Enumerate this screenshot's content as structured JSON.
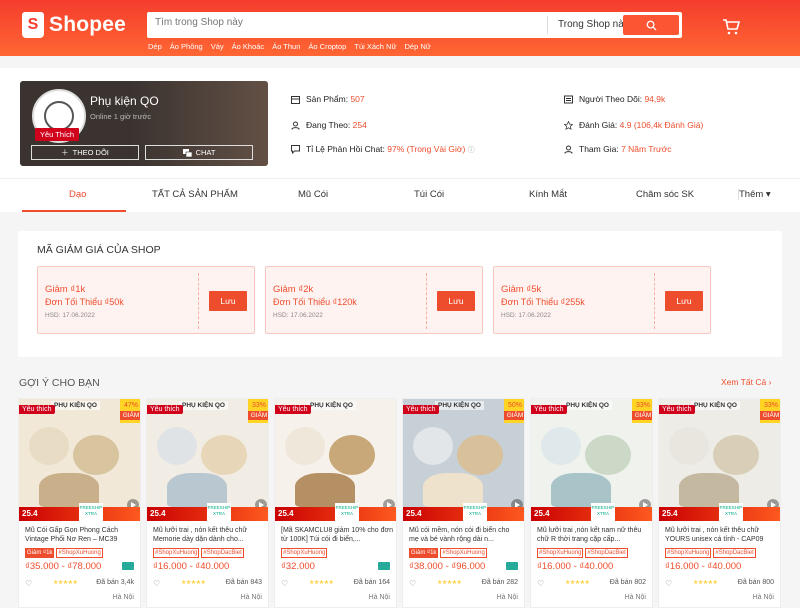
{
  "header": {
    "logo_text": "Shopee",
    "logo_mark": "S",
    "search_placeholder": "Tìm trong Shop này",
    "search_scope": "Trong Shop này",
    "hints": [
      "Dép",
      "Áo Phông",
      "Váy",
      "Áo Khoác",
      "Áo Thun",
      "Áo Croptop",
      "Túi Xách Nữ",
      "Dép Nữ"
    ],
    "colors": {
      "brand": "#ee4d2d"
    }
  },
  "shop": {
    "name": "Phụ kiện QO",
    "online": "Online 1 giờ trước",
    "favorite_badge": "Yêu Thích",
    "follow_label": "THEO DÕI",
    "follow_icon": "plus-icon",
    "chat_label": "CHAT",
    "chat_icon": "chat-icon",
    "stats": {
      "products_label": "Sản Phẩm:",
      "products": "507",
      "following_label": "Đang Theo:",
      "following": "254",
      "chat_label": "Tỉ Lệ Phản Hồi Chat:",
      "chat": "97% (Trong Vài Giờ)",
      "followers_label": "Người Theo Dõi:",
      "followers": "94,9k",
      "rating_label": "Đánh Giá:",
      "rating": "4.9 (106,4k Đánh Giá)",
      "joined_label": "Tham Gia:",
      "joined": "7 Năm Trước"
    }
  },
  "tabs": [
    "Dạo",
    "TẤT CẢ SẢN PHẨM",
    "Mũ Cói",
    "Túi Cói",
    "Kính Mắt",
    "Chăm sóc SK"
  ],
  "more_tab": "Thêm ▾",
  "vouchers": {
    "title": "MÃ GIẢM GIÁ CỦA SHOP",
    "items": [
      {
        "amount": "Giảm ₫1k",
        "min": "Đơn Tối Thiểu ₫50k",
        "expiry": "HSD: 17.06.2022",
        "button": "Lưu"
      },
      {
        "amount": "Giảm ₫2k",
        "min": "Đơn Tối Thiểu ₫120k",
        "expiry": "HSD: 17.06.2022",
        "button": "Lưu"
      },
      {
        "amount": "Giảm ₫5k",
        "min": "Đơn Tối Thiểu ₫255k",
        "expiry": "HSD: 17.06.2022",
        "button": "Lưu"
      }
    ]
  },
  "recommend": {
    "title": "GỢI Ý CHO BẠN",
    "see_all": "Xem Tất Cả",
    "see_all_arrow": "›",
    "products": [
      {
        "favorite": "Yêu thích",
        "brand": "PHỤ KIỆN QO",
        "discount": "47%",
        "discount_label": "GIẢM",
        "promo_date": "25.4",
        "freeship": "FREESHIP XTRA",
        "name": "Mũ Cói Gấp Gọn Phong Cách Vintage Phối Nơ Ren – MC39",
        "tags": [
          "Giảm ₫1k",
          "#ShopXuHuong"
        ],
        "price": "₫35.000 - ₫78.000",
        "sold": "Đã bán 3,4k",
        "location": "Hà Nội",
        "truck": true,
        "heart": "♡",
        "stars": "★★★★★"
      },
      {
        "favorite": "Yêu thích",
        "brand": "PHỤ KIỆN QO",
        "discount": "33%",
        "discount_label": "GIẢM",
        "promo_date": "25.4",
        "freeship": "FREESHIP XTRA",
        "name": "Mũ lưỡi trai , nón kết thêu chữ Memorie dày dặn dành cho...",
        "tags": [
          "#ShopXuHuong",
          "#ShopDacBiet"
        ],
        "price": "₫16.000 - ₫40.000",
        "sold": "Đã bán 843",
        "location": "Hà Nội",
        "truck": false,
        "heart": "♡",
        "stars": "★★★★★"
      },
      {
        "favorite": "Yêu thích",
        "brand": "PHỤ KIỆN QO",
        "discount": "",
        "discount_label": "",
        "promo_date": "25.4",
        "freeship": "FREESHIP XTRA",
        "name": "[Mã SKAMCLU8 giảm 10% cho đơn từ 100K] Túi cói đi biển,...",
        "tags": [
          "#ShopXuHuong"
        ],
        "price": "₫32.000",
        "sold": "Đã bán 164",
        "location": "Hà Nội",
        "truck": true,
        "heart": "♡",
        "stars": "★★★★★"
      },
      {
        "favorite": "Yêu thích",
        "brand": "PHỤ KIỆN QO",
        "discount": "50%",
        "discount_label": "GIẢM",
        "promo_date": "25.4",
        "freeship": "FREESHIP XTRA",
        "name": "Mũ cói mềm, nón cói đi biển cho mẹ và bé vành rộng dài n...",
        "tags": [
          "Giảm ₫1k",
          "#ShopXuHuong"
        ],
        "price": "₫38.000 - ₫96.000",
        "sold": "Đã bán 282",
        "location": "Hà Nội",
        "truck": true,
        "heart": "♡",
        "stars": "★★★★★"
      },
      {
        "favorite": "Yêu thích",
        "brand": "PHỤ KIỆN QO",
        "discount": "33%",
        "discount_label": "GIẢM",
        "promo_date": "25.4",
        "freeship": "FREESHIP XTRA",
        "name": "Mũ lưỡi trai ,nón kết nam nữ thêu chữ R thời trang cặp cấp...",
        "tags": [
          "#ShopXuHuong",
          "#ShopDacBiet"
        ],
        "price": "₫16.000 - ₫40.000",
        "sold": "Đã bán 802",
        "location": "Hà Nội",
        "truck": false,
        "heart": "♡",
        "stars": "★★★★★"
      },
      {
        "favorite": "Yêu thích",
        "brand": "PHỤ KIỆN QO",
        "discount": "33%",
        "discount_label": "GIẢM",
        "promo_date": "25.4",
        "freeship": "FREESHIP XTRA",
        "name": "Mũ lưỡi trai , nón kết thêu chữ YOURS unisex cá tính - CAP09",
        "tags": [
          "#ShopXuHuong",
          "#ShopDacBiet"
        ],
        "price": "₫16.000 - ₫40.000",
        "sold": "Đã bán 800",
        "location": "Hà Nội",
        "truck": false,
        "heart": "♡",
        "stars": "★★★★★"
      }
    ]
  }
}
